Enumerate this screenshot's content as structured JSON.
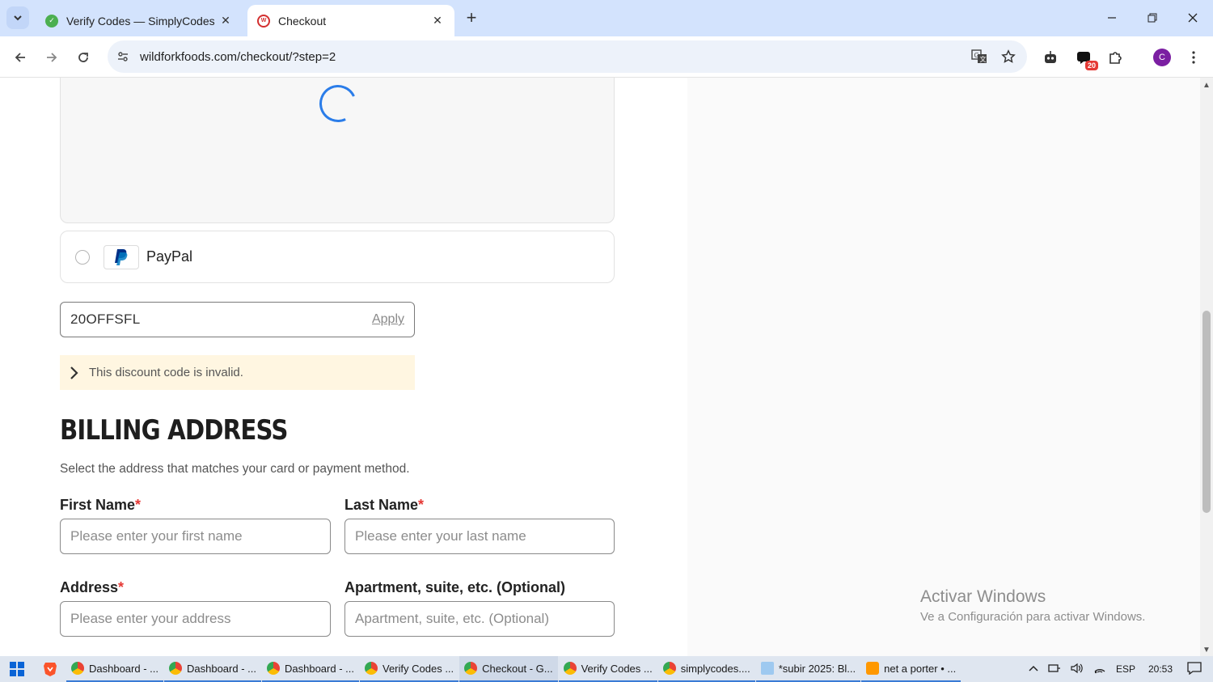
{
  "browser": {
    "tabs": [
      {
        "title": "Verify Codes — SimplyCodes",
        "active": false
      },
      {
        "title": "Checkout",
        "active": true
      }
    ],
    "url": "wildforkfoods.com/checkout/?step=2",
    "extension_badge": "20",
    "profile_initial": "C"
  },
  "payment": {
    "paypal_label": "PayPal"
  },
  "discount": {
    "code": "20OFFSFL",
    "apply_label": "Apply",
    "error": "This discount code is invalid."
  },
  "billing": {
    "title": "BILLING ADDRESS",
    "subtitle": "Select the address that matches your card or payment method.",
    "required_mark": "*",
    "first_name": {
      "label": "First Name",
      "placeholder": "Please enter your first name"
    },
    "last_name": {
      "label": "Last Name",
      "placeholder": "Please enter your last name"
    },
    "address": {
      "label": "Address",
      "placeholder": "Please enter your address"
    },
    "apartment": {
      "label": "Apartment, suite, etc. (Optional)",
      "placeholder": "Apartment, suite, etc. (Optional)"
    }
  },
  "watermark": {
    "line1": "Activar Windows",
    "line2": "Ve a Configuración para activar Windows."
  },
  "taskbar": {
    "items": [
      "Dashboard - ...",
      "Dashboard - ...",
      "Dashboard - ...",
      "Verify Codes ...",
      "Checkout - G...",
      "Verify Codes ...",
      "simplycodes....",
      "*subir 2025: Bl...",
      "net a porter • ..."
    ],
    "language": "ESP",
    "time": "20:53"
  },
  "colors": {
    "tabbar": "#d3e3fd",
    "accent_spinner": "#2b7de9",
    "error_bg": "#fff6e1",
    "required": "#e53935"
  }
}
